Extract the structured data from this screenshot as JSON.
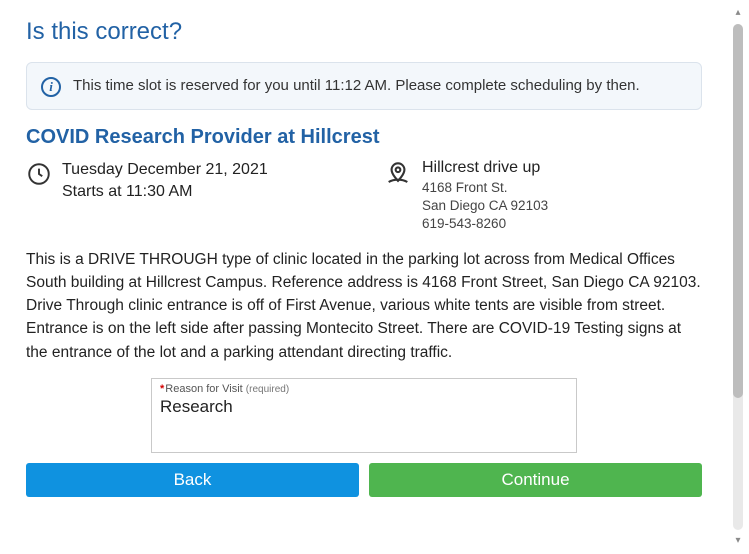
{
  "title": "Is this correct?",
  "alert": {
    "icon_glyph": "i",
    "text": "This time slot is reserved for you until 11:12 AM. Please complete scheduling by then."
  },
  "clinic": {
    "name": "COVID Research Provider at Hillcrest",
    "date_line": "Tuesday December 21, 2021",
    "time_line": "Starts at 11:30 AM",
    "location_name": "Hillcrest drive up",
    "address_line1": "4168 Front St.",
    "address_line2": "San Diego CA 92103",
    "phone": "619-543-8260"
  },
  "description": "This is a DRIVE THROUGH type of clinic located in the parking lot across from Medical Offices South building at Hillcrest Campus. Reference address is 4168 Front Street, San Diego CA 92103. Drive Through clinic entrance is off of First Avenue, various white tents are visible from street. Entrance is on the left side after passing Montecito Street. There are COVID-19 Testing signs at the entrance of the lot and a parking attendant directing traffic.",
  "form": {
    "reason_label": "Reason for Visit",
    "required_word": "(required)",
    "asterisk": "*",
    "reason_value": "Research"
  },
  "buttons": {
    "back": "Back",
    "continue": "Continue"
  }
}
